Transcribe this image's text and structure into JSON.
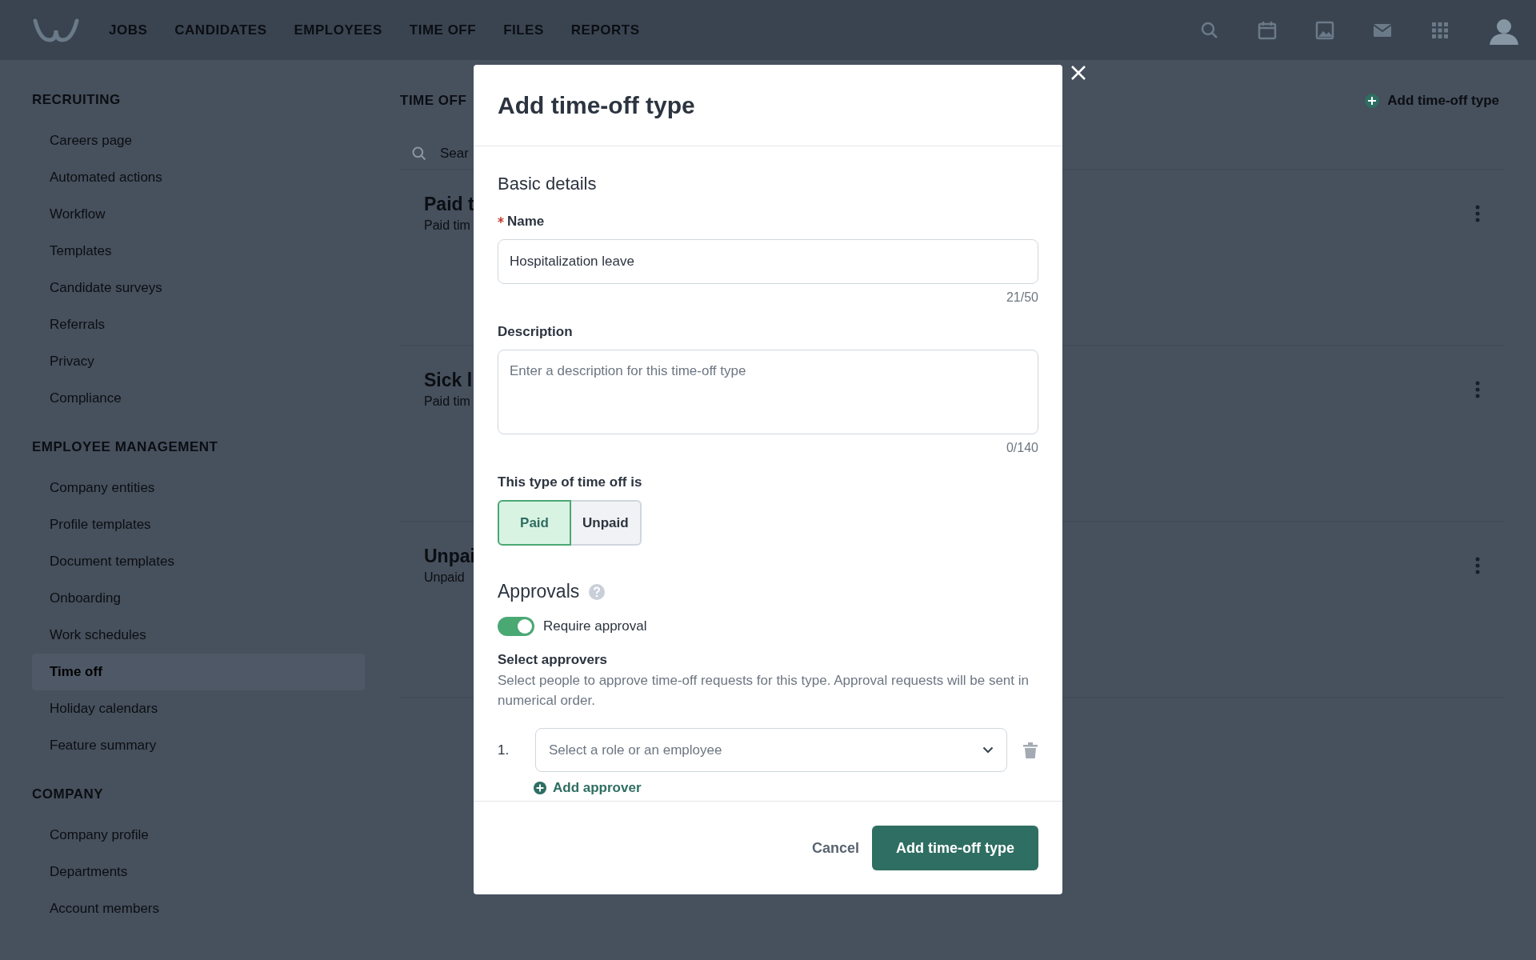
{
  "nav": {
    "items": [
      {
        "label": "JOBS"
      },
      {
        "label": "CANDIDATES"
      },
      {
        "label": "EMPLOYEES"
      },
      {
        "label": "TIME OFF"
      },
      {
        "label": "FILES"
      },
      {
        "label": "REPORTS"
      }
    ]
  },
  "sidebar": {
    "sections": [
      {
        "title": "RECRUITING",
        "items": [
          {
            "label": "Careers page",
            "selected": false
          },
          {
            "label": "Automated actions",
            "selected": false
          },
          {
            "label": "Workflow",
            "selected": false
          },
          {
            "label": "Templates",
            "selected": false
          },
          {
            "label": "Candidate surveys",
            "selected": false
          },
          {
            "label": "Referrals",
            "selected": false
          },
          {
            "label": "Privacy",
            "selected": false
          },
          {
            "label": "Compliance",
            "selected": false
          }
        ]
      },
      {
        "title": "EMPLOYEE MANAGEMENT",
        "items": [
          {
            "label": "Company entities",
            "selected": false
          },
          {
            "label": "Profile templates",
            "selected": false
          },
          {
            "label": "Document templates",
            "selected": false
          },
          {
            "label": "Onboarding",
            "selected": false
          },
          {
            "label": "Work schedules",
            "selected": false
          },
          {
            "label": "Time off",
            "selected": true
          },
          {
            "label": "Holiday calendars",
            "selected": false
          },
          {
            "label": "Feature summary",
            "selected": false
          }
        ]
      },
      {
        "title": "COMPANY",
        "items": [
          {
            "label": "Company profile",
            "selected": false
          },
          {
            "label": "Departments",
            "selected": false
          },
          {
            "label": "Account members",
            "selected": false
          }
        ]
      }
    ]
  },
  "main": {
    "title": "TIME OFF",
    "add_button": "Add time-off type",
    "search": {
      "placeholder": "Sear"
    },
    "cards": [
      {
        "title": "Paid t",
        "subtitle": "Paid tim"
      },
      {
        "title": "Sick l",
        "subtitle": "Paid tim"
      },
      {
        "title": "Unpai",
        "subtitle": "Unpaid"
      }
    ]
  },
  "modal": {
    "title": "Add time-off type",
    "section": "Basic details",
    "name": {
      "label": "Name",
      "required": true,
      "value": "Hospitalization leave",
      "counter": "21/50"
    },
    "description": {
      "label": "Description",
      "placeholder": "Enter a description for this time-off type",
      "counter": "0/140"
    },
    "pay_type": {
      "label": "This type of time off is",
      "options": [
        {
          "label": "Paid",
          "selected": true
        },
        {
          "label": "Unpaid",
          "selected": false
        }
      ]
    },
    "approvals": {
      "title": "Approvals",
      "toggle": {
        "label": "Require approval",
        "on": true
      },
      "approvers_title": "Select approvers",
      "approvers_help": "Select people to approve time-off requests for this type. Approval requests will be sent in numerical order.",
      "approvers": [
        {
          "number": "1.",
          "placeholder": "Select a role or an employee"
        }
      ],
      "add_label": "Add approver"
    },
    "cancel": "Cancel",
    "submit": "Add time-off type"
  }
}
